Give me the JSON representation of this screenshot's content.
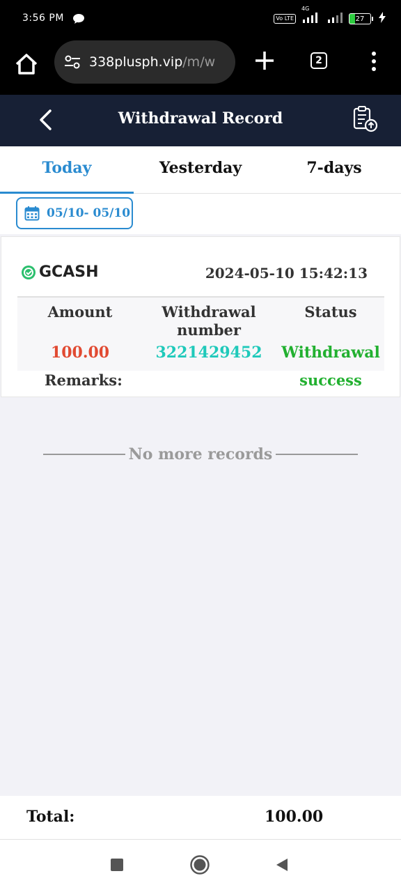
{
  "status_bar": {
    "time": "3:56 PM",
    "network": "4G",
    "volte": "Vo LTE",
    "battery": "27"
  },
  "browser": {
    "url_host": "338plusph.vip",
    "url_path": "/m/w",
    "tab_count": "2"
  },
  "header": {
    "title": "Withdrawal Record"
  },
  "tabs": [
    {
      "label": "Today",
      "active": true
    },
    {
      "label": "Yesterday",
      "active": false
    },
    {
      "label": "7-days",
      "active": false
    }
  ],
  "date_filter": {
    "range": "05/10- 05/10"
  },
  "record": {
    "channel": "GCASH",
    "datetime": "2024-05-10 15:42:13",
    "amount_label": "Amount",
    "number_label": "Withdrawal number",
    "status_label": "Status",
    "amount": "100.00",
    "number": "3221429452",
    "status_line1": "Withdrawal",
    "status_line2": "success",
    "remarks_label": "Remarks:",
    "remarks_value": ""
  },
  "list_end": "No more records",
  "total": {
    "label": "Total:",
    "value": "100.00"
  },
  "colors": {
    "header_bg": "#172035",
    "accent": "#2a8bd0",
    "amount": "#e14a32",
    "number": "#1fc9ba",
    "success": "#22b030"
  }
}
